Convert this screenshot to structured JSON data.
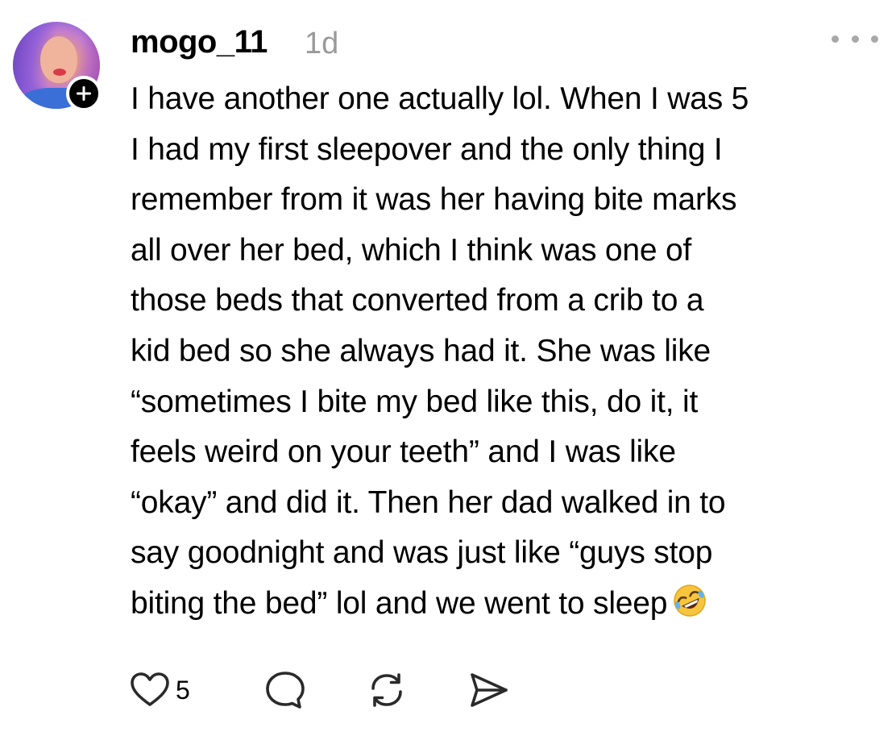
{
  "post": {
    "username": "mogo_11",
    "timestamp": "1d",
    "body_lines": [
      "I have another one actually lol. When I was 5",
      "I had my first sleepover and the only thing I",
      "remember from it was her having bite marks",
      "all over her bed, which I think was one of",
      "those beds that converted from a crib to a",
      "kid bed so she always had it. She was like",
      "“sometimes I bite my bed like this, do it, it",
      "feels weird on your teeth” and I was like",
      "“okay” and did it. Then her dad walked in to",
      "say goodnight and was just like “guys stop",
      "biting the bed” lol and we went to sleep"
    ],
    "trailing_emoji": "rolling-on-floor-laughing-emoji",
    "like_count": "5"
  },
  "icons": {
    "more": "more-horizontal-icon",
    "follow": "plus-icon",
    "like": "heart-icon",
    "reply": "comment-bubble-icon",
    "repost": "repost-icon",
    "share": "send-icon"
  },
  "colors": {
    "text": "#000000",
    "muted": "#9a9a9a",
    "icon": "#2a2a2a",
    "emoji_face": "#f7c53d"
  }
}
